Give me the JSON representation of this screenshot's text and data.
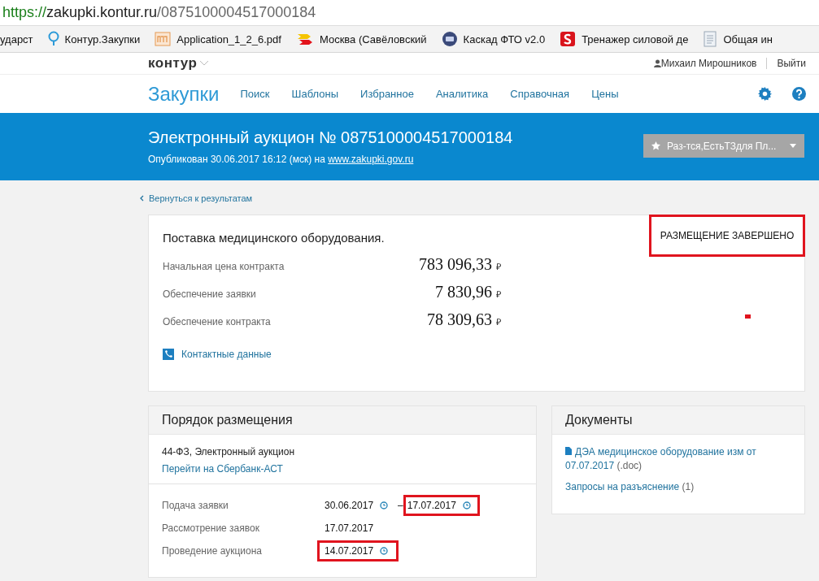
{
  "address_bar": {
    "scheme": "https://",
    "host": "zakupki.kontur.ru",
    "path": "/0875100004517000184"
  },
  "bookmarks": [
    {
      "label": "ударст",
      "kind": "none"
    },
    {
      "label": "Контур.Закупки",
      "kind": "pin"
    },
    {
      "label": "Application_1_2_6.pdf",
      "kind": "doc"
    },
    {
      "label": "Москва (Савёловский",
      "kind": "arrows"
    },
    {
      "label": "Каскад ФТО v2.0",
      "kind": "disc"
    },
    {
      "label": "Тренажер силовой де",
      "kind": "badge"
    },
    {
      "label": "Общая ин",
      "kind": "page"
    }
  ],
  "header": {
    "logo": "контур",
    "user": "Михаил Мирошников",
    "logout": "Выйти"
  },
  "nav": {
    "title": "Закупки",
    "items": [
      "Поиск",
      "Шаблоны",
      "Избранное",
      "Аналитика",
      "Справочная",
      "Цены"
    ]
  },
  "banner": {
    "title": "Электронный аукцион № 0875100004517000184",
    "published": "Опубликован 30.06.2017 16:12 (мск) на",
    "site": "www.zakupki.gov.ru",
    "tag_button": "Раз-тся,ЕстьТЗдля Пл..."
  },
  "back_link": "Вернуться к результатам",
  "summary": {
    "subject": "Поставка медицинского оборудования.",
    "status": "РАЗМЕЩЕНИЕ ЗАВЕРШЕНО",
    "status_highlighted": true,
    "rows": [
      {
        "label": "Начальная цена контракта",
        "value": "783 096,33",
        "currency": "₽"
      },
      {
        "label": "Обеспечение заявки",
        "value": "7 830,96",
        "currency": "₽"
      },
      {
        "label": "Обеспечение контракта",
        "value": "78 309,63",
        "currency": "₽"
      }
    ],
    "contacts": "Контактные данные"
  },
  "procedure": {
    "title": "Порядок размещения",
    "law": "44-ФЗ, Электронный аукцион",
    "platform_link": "Перейти на Сбербанк-АСТ",
    "dates": [
      {
        "label": "Подача заявки",
        "start": "30.06.2017",
        "start_clock": true,
        "dash": "–",
        "end": "17.07.2017",
        "end_clock": true,
        "highlighted": true
      },
      {
        "label": "Рассмотрение заявок",
        "start": "17.07.2017",
        "start_clock": false,
        "highlighted": false
      },
      {
        "label": "Проведение аукциона",
        "start": "14.07.2017",
        "start_clock": true,
        "highlighted": true
      }
    ]
  },
  "documents": {
    "title": "Документы",
    "items": [
      {
        "kind": "file",
        "link": "ДЭА медицинское оборудование изм от 07.07.2017",
        "note": "(.doc)"
      },
      {
        "kind": "plain",
        "link": "Запросы на разъяснение",
        "note": "(1)"
      }
    ]
  }
}
